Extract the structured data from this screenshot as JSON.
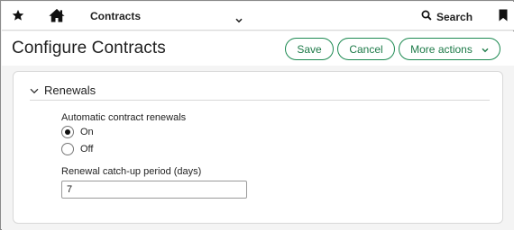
{
  "topbar": {
    "module": "Contracts",
    "search_label": "Search"
  },
  "header": {
    "title": "Configure Contracts",
    "save_label": "Save",
    "cancel_label": "Cancel",
    "more_label": "More actions"
  },
  "renewals": {
    "section_title": "Renewals",
    "auto_renew_label": "Automatic contract renewals",
    "options": [
      {
        "label": "On",
        "selected": true
      },
      {
        "label": "Off",
        "selected": false
      }
    ],
    "catchup_label": "Renewal catch-up period (days)",
    "catchup_value": "7"
  },
  "colors": {
    "accent": "#1d8a52"
  },
  "icons": {
    "star": "star-icon",
    "home": "home-icon",
    "nav_dropdown": "chevron-down-icon",
    "search": "search-icon",
    "bookmark": "bookmark-icon",
    "section_toggle": "chevron-down-icon"
  }
}
